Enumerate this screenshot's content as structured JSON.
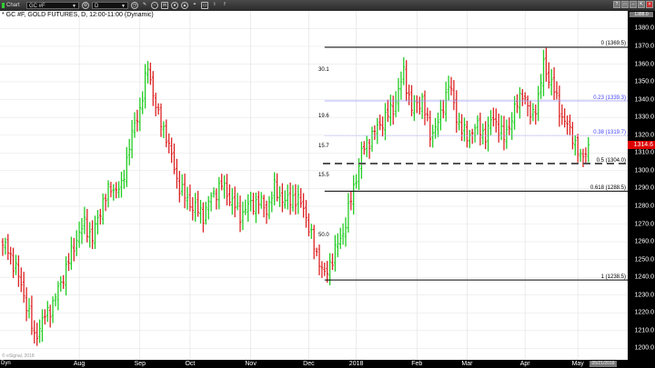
{
  "toolbar": {
    "chart_label": "Chart",
    "symbol_value": "GC #F",
    "interval_value": "D",
    "icons": [
      "settings-icon",
      "clock-icon",
      "pencil-icon",
      "minus-circle-icon",
      "mail-icon",
      "record-icon",
      "alert-icon",
      "link-icon",
      "chat-icon",
      "twitter-icon",
      "facebook-icon"
    ],
    "window_buttons": [
      "?",
      "□",
      "–",
      "⇱",
      "×"
    ]
  },
  "title": "* GC #F, GOLD FUTURES, D, 12:00-11:00 (Dynamic)",
  "axis_top_label": "1388.0",
  "current_price": "1314.6",
  "date_box": "05/21/2018",
  "dyn_label": "Dyn",
  "watermark": "© eSignal, 2018",
  "colors": {
    "up": "#22cc22",
    "down": "#dd2222",
    "fib_blue": "#4444ff",
    "badge": "#dd0000"
  },
  "chart_data": {
    "type": "ohlc",
    "symbol": "GC #F",
    "ylim": [
      1195,
      1385
    ],
    "y_ticks": [
      1380,
      1370,
      1360,
      1350,
      1340,
      1330,
      1320,
      1310,
      1300,
      1290,
      1280,
      1270,
      1260,
      1250,
      1240,
      1230,
      1220,
      1210,
      1200
    ],
    "y_tick_labels": [
      "1380.0",
      "1370.0",
      "1360.0",
      "1350.0",
      "1340.0",
      "1330.0",
      "1320.0",
      "1310.0",
      "1300.0",
      "1290.0",
      "1280.0",
      "1270.0",
      "1260.0",
      "1250.0",
      "1240.0",
      "1230.0",
      "1220.0",
      "1210.0",
      "1200.0"
    ],
    "x_labels": [
      {
        "label": "Aug",
        "bar": 29
      },
      {
        "label": "Sep",
        "bar": 52
      },
      {
        "label": "Oct",
        "bar": 71
      },
      {
        "label": "Nov",
        "bar": 94
      },
      {
        "label": "Dec",
        "bar": 116
      },
      {
        "label": "2018",
        "bar": 134
      },
      {
        "label": "Feb",
        "bar": 157
      },
      {
        "label": "Mar",
        "bar": 176
      },
      {
        "label": "Apr",
        "bar": 198
      },
      {
        "label": "May",
        "bar": 218
      }
    ],
    "close_keypoints": [
      [
        0,
        1258
      ],
      [
        2,
        1255
      ],
      [
        5,
        1245
      ],
      [
        9,
        1225
      ],
      [
        12,
        1206
      ],
      [
        16,
        1218
      ],
      [
        19,
        1225
      ],
      [
        24,
        1245
      ],
      [
        28,
        1262
      ],
      [
        31,
        1270
      ],
      [
        34,
        1262
      ],
      [
        38,
        1283
      ],
      [
        41,
        1290
      ],
      [
        45,
        1290
      ],
      [
        48,
        1315
      ],
      [
        52,
        1335
      ],
      [
        55,
        1358
      ],
      [
        59,
        1330
      ],
      [
        62,
        1320
      ],
      [
        66,
        1295
      ],
      [
        69,
        1285
      ],
      [
        72,
        1280
      ],
      [
        76,
        1275
      ],
      [
        79,
        1285
      ],
      [
        83,
        1292
      ],
      [
        86,
        1285
      ],
      [
        90,
        1275
      ],
      [
        93,
        1280
      ],
      [
        97,
        1283
      ],
      [
        100,
        1278
      ],
      [
        103,
        1290
      ],
      [
        107,
        1282
      ],
      [
        110,
        1285
      ],
      [
        114,
        1280
      ],
      [
        117,
        1262
      ],
      [
        121,
        1245
      ],
      [
        122,
        1240
      ],
      [
        126,
        1255
      ],
      [
        129,
        1265
      ],
      [
        133,
        1290
      ],
      [
        136,
        1310
      ],
      [
        140,
        1320
      ],
      [
        145,
        1330
      ],
      [
        148,
        1335
      ],
      [
        152,
        1355
      ],
      [
        155,
        1335
      ],
      [
        159,
        1340
      ],
      [
        162,
        1320
      ],
      [
        166,
        1330
      ],
      [
        169,
        1350
      ],
      [
        172,
        1330
      ],
      [
        176,
        1318
      ],
      [
        179,
        1325
      ],
      [
        183,
        1320
      ],
      [
        186,
        1330
      ],
      [
        190,
        1318
      ],
      [
        193,
        1330
      ],
      [
        197,
        1345
      ],
      [
        200,
        1330
      ],
      [
        203,
        1340
      ],
      [
        205,
        1360
      ],
      [
        209,
        1345
      ],
      [
        212,
        1330
      ],
      [
        216,
        1320
      ],
      [
        219,
        1306
      ],
      [
        222,
        1314.6
      ]
    ],
    "fibonacci": {
      "levels": [
        {
          "ratio": "0",
          "price": 1369.5,
          "label": "0 (1369.5)",
          "style": "solid-black"
        },
        {
          "ratio": "0.23",
          "price": 1339.3,
          "label": "0.23 (1339.3)",
          "style": "blue"
        },
        {
          "ratio": "0.38",
          "price": 1319.7,
          "label": "0.38 (1319.7)",
          "style": "blue-dotted"
        },
        {
          "ratio": "0.5",
          "price": 1304.0,
          "label": "0.5 (1304.0)",
          "style": "dashed-gray"
        },
        {
          "ratio": "0.618",
          "price": 1288.5,
          "label": "0.618 (1288.5)",
          "style": "solid-black"
        },
        {
          "ratio": "1",
          "price": 1238.5,
          "label": "1 (1238.5)",
          "style": "solid-black"
        }
      ],
      "start_bar": 122,
      "percent_labels": [
        {
          "text": "30.1",
          "price": 1356
        },
        {
          "text": "19.6",
          "price": 1330
        },
        {
          "text": "15.7",
          "price": 1313
        },
        {
          "text": "15.5",
          "price": 1297
        },
        {
          "text": "50.0",
          "price": 1263
        }
      ]
    }
  }
}
